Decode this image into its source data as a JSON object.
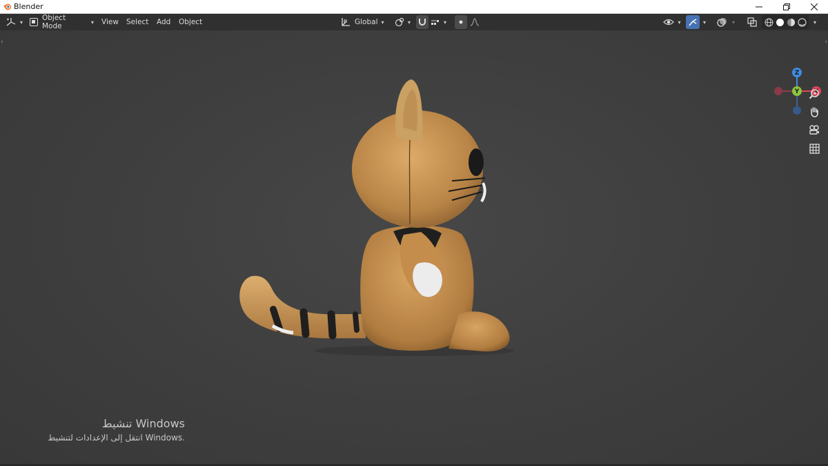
{
  "window": {
    "title": "Blender",
    "controls": {
      "minimize": "—",
      "restore": "❐",
      "close": "✕"
    }
  },
  "header": {
    "editor_type_icon": "view3d-icon",
    "mode": "Object Mode",
    "menus": [
      "View",
      "Select",
      "Add",
      "Object"
    ],
    "transform_orientation": "Global"
  },
  "gizmo": {
    "axes": {
      "z": "Z",
      "y": "Y",
      "x": "X"
    },
    "colors": {
      "x": "#e0455c",
      "y": "#8cc63f",
      "z": "#3f8ce0"
    }
  },
  "watermark": {
    "title": "تنشيط Windows",
    "subtitle": "انتقل إلى الإعدادات لتنشيط Windows."
  },
  "colors": {
    "header_bg": "#303030",
    "viewport_bg": "#3d3d3d",
    "accent_blue": "#4772b3",
    "cat_body": "#c8934e"
  }
}
